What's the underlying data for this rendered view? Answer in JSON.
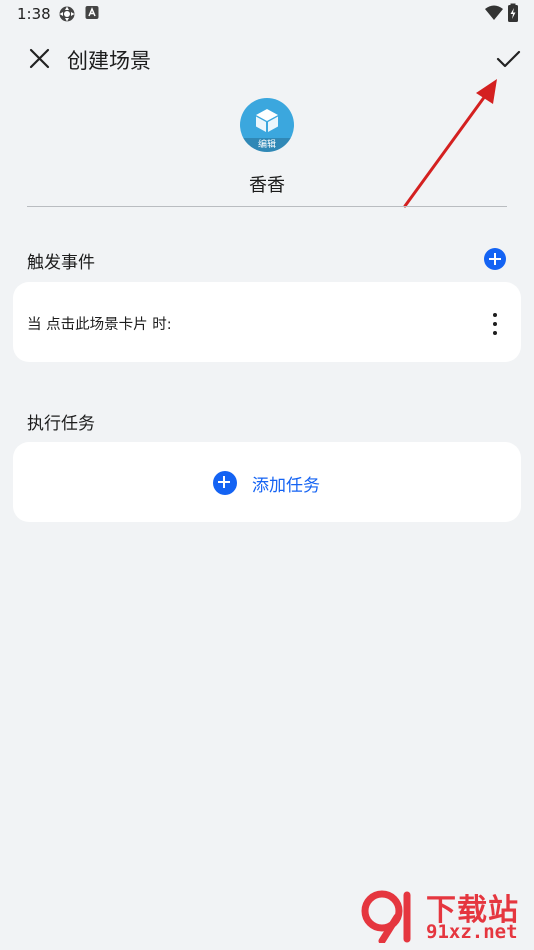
{
  "status_bar": {
    "time": "1:38",
    "icons": [
      "settings-gear-icon",
      "keyboard-a-icon",
      "wifi-icon",
      "battery-charging-icon"
    ]
  },
  "app_bar": {
    "title": "创建场景",
    "close_icon": "close-icon",
    "confirm_icon": "checkmark-icon"
  },
  "scene": {
    "icon": "cube-icon",
    "icon_color": "#3ba7de",
    "edit_label": "编辑",
    "name": "香香"
  },
  "trigger_section": {
    "label": "触发事件",
    "add_icon": "add-circle-icon",
    "items": [
      {
        "text": "当 点击此场景卡片 时:"
      }
    ]
  },
  "task_section": {
    "label": "执行任务",
    "add_label": "添加任务"
  },
  "colors": {
    "accent": "#1463f3",
    "background": "#f1f3f5",
    "card": "#ffffff",
    "annotation_arrow": "#d42020",
    "watermark": "#e5363f"
  },
  "watermark": {
    "brand": "下载站",
    "site": "91xz.net"
  }
}
